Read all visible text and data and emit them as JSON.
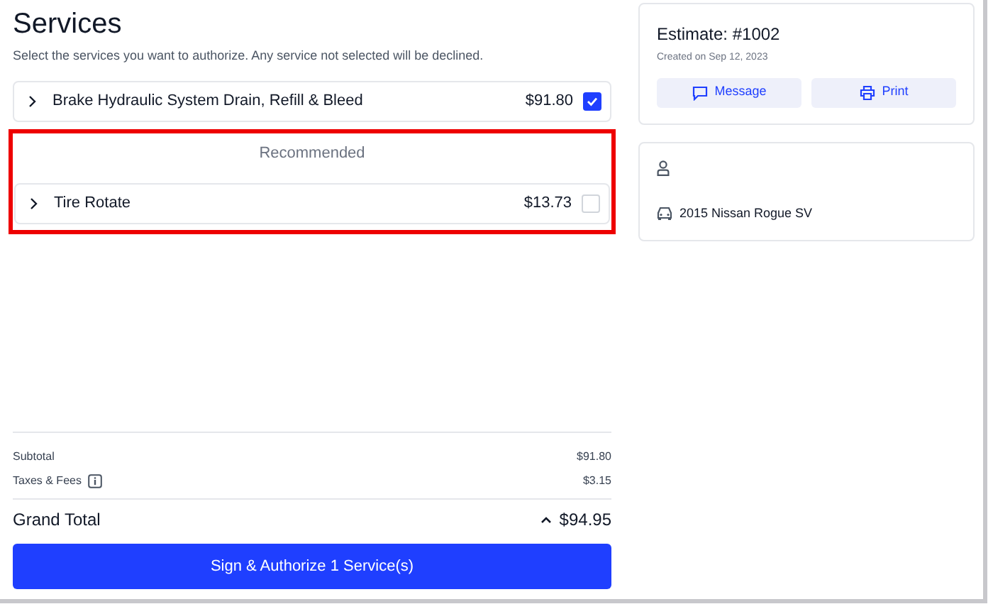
{
  "title": "Services",
  "subtitle": "Select the services you want to authorize. Any service not selected will be declined.",
  "services": [
    {
      "name": "Brake Hydraulic System Drain, Refill & Bleed",
      "price": "$91.80",
      "checked": true
    }
  ],
  "recommended": {
    "label": "Recommended",
    "services": [
      {
        "name": "Tire Rotate",
        "price": "$13.73",
        "checked": false
      }
    ]
  },
  "totals": [
    {
      "label": "Subtotal",
      "value": "$91.80",
      "info": false
    },
    {
      "label": "Taxes & Fees",
      "value": "$3.15",
      "info": true
    }
  ],
  "grand_total": {
    "label": "Grand Total",
    "value": "$94.95",
    "expanded": true
  },
  "authorize_button": "Sign & Authorize 1 Service(s)",
  "estimate": {
    "title": "Estimate: #1002",
    "created": "Created on Sep 12, 2023",
    "buttons": [
      {
        "label": "Message",
        "kind": "message"
      },
      {
        "label": "Print",
        "kind": "print"
      }
    ]
  },
  "vehicle": "2015 Nissan Rogue SV"
}
